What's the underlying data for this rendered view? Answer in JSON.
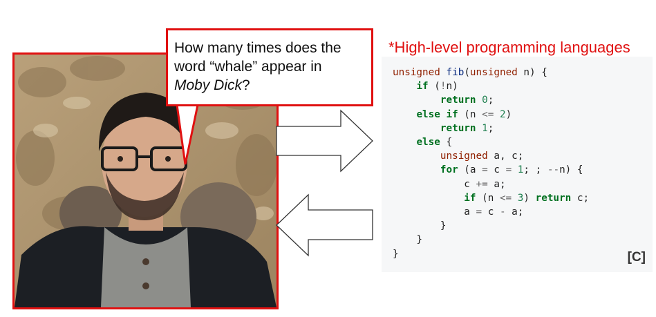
{
  "callout": {
    "line1": "How many times does the",
    "line2": "word “whale” appear in",
    "title_italic": "Moby Dick",
    "end": "?"
  },
  "heading": "*High-level programming languages",
  "code": {
    "lines": [
      [
        {
          "t": "unsigned",
          "c": "ty"
        },
        {
          "t": " "
        },
        {
          "t": "fib",
          "c": "fn"
        },
        {
          "t": "("
        },
        {
          "t": "unsigned",
          "c": "ty"
        },
        {
          "t": " n) {"
        }
      ],
      [
        {
          "t": "    "
        },
        {
          "t": "if",
          "c": "kw"
        },
        {
          "t": " ("
        },
        {
          "t": "!",
          "c": "op"
        },
        {
          "t": "n)"
        }
      ],
      [
        {
          "t": "        "
        },
        {
          "t": "return",
          "c": "kw"
        },
        {
          "t": " "
        },
        {
          "t": "0",
          "c": "nm"
        },
        {
          "t": ";"
        }
      ],
      [
        {
          "t": "    "
        },
        {
          "t": "else",
          "c": "kw"
        },
        {
          "t": " "
        },
        {
          "t": "if",
          "c": "kw"
        },
        {
          "t": " (n "
        },
        {
          "t": "<=",
          "c": "op"
        },
        {
          "t": " "
        },
        {
          "t": "2",
          "c": "nm"
        },
        {
          "t": ")"
        }
      ],
      [
        {
          "t": "        "
        },
        {
          "t": "return",
          "c": "kw"
        },
        {
          "t": " "
        },
        {
          "t": "1",
          "c": "nm"
        },
        {
          "t": ";"
        }
      ],
      [
        {
          "t": "    "
        },
        {
          "t": "else",
          "c": "kw"
        },
        {
          "t": " {"
        }
      ],
      [
        {
          "t": "        "
        },
        {
          "t": "unsigned",
          "c": "ty"
        },
        {
          "t": " a, c;"
        }
      ],
      [
        {
          "t": "        "
        },
        {
          "t": "for",
          "c": "kw"
        },
        {
          "t": " (a "
        },
        {
          "t": "=",
          "c": "op"
        },
        {
          "t": " c "
        },
        {
          "t": "=",
          "c": "op"
        },
        {
          "t": " "
        },
        {
          "t": "1",
          "c": "nm"
        },
        {
          "t": "; ; "
        },
        {
          "t": "--",
          "c": "op"
        },
        {
          "t": "n) {"
        }
      ],
      [
        {
          "t": "            c "
        },
        {
          "t": "+=",
          "c": "op"
        },
        {
          "t": " a;"
        }
      ],
      [
        {
          "t": "            "
        },
        {
          "t": "if",
          "c": "kw"
        },
        {
          "t": " (n "
        },
        {
          "t": "<=",
          "c": "op"
        },
        {
          "t": " "
        },
        {
          "t": "3",
          "c": "nm"
        },
        {
          "t": ") "
        },
        {
          "t": "return",
          "c": "kw"
        },
        {
          "t": " c;"
        }
      ],
      [
        {
          "t": "            a "
        },
        {
          "t": "=",
          "c": "op"
        },
        {
          "t": " c "
        },
        {
          "t": "-",
          "c": "op"
        },
        {
          "t": " a;"
        }
      ],
      [
        {
          "t": "        }"
        }
      ],
      [
        {
          "t": "    }"
        }
      ],
      [
        {
          "t": "}"
        }
      ]
    ],
    "language_tag": "[C]"
  },
  "colors": {
    "accent_red": "#e01010",
    "code_background": "#f6f7f8",
    "keyword": "#007020",
    "type": "#902000",
    "function": "#06287e",
    "number": "#208050"
  }
}
